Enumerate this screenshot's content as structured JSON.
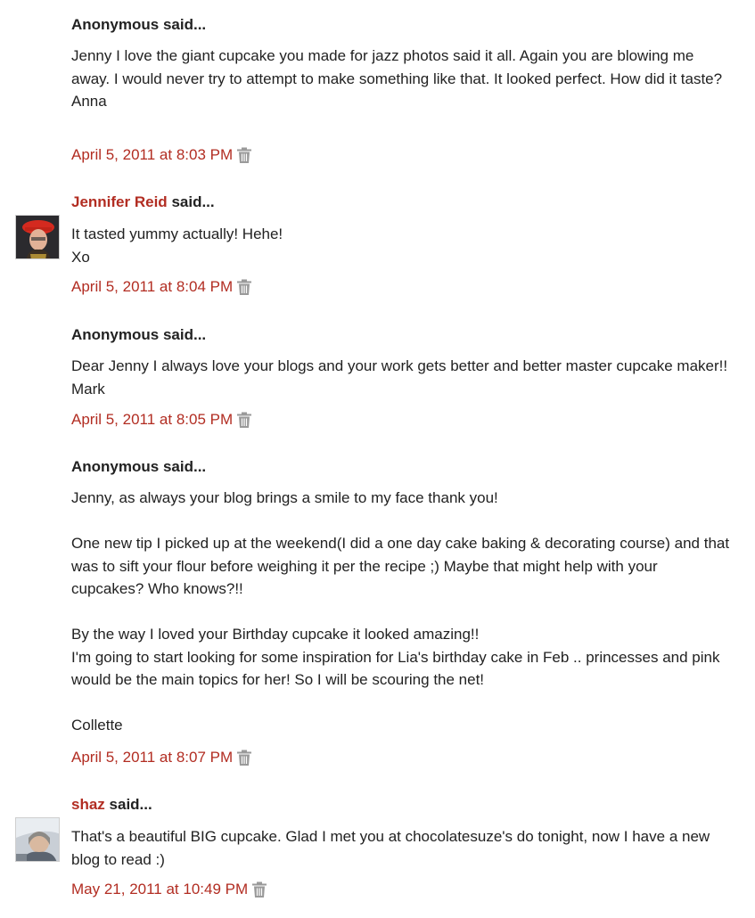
{
  "colors": {
    "link": "#b22d22",
    "text": "#222222",
    "icon": "#9a9a9a"
  },
  "comments": [
    {
      "author": "Anonymous",
      "said": "said...",
      "body": [
        "Jenny I love the giant cupcake you made for jazz photos said it all. Again you are blowing me away. I would never try to attempt to make something like that. It looked perfect. How did it taste?",
        "Anna"
      ],
      "timestamp": "April 5, 2011 at 8:03 PM",
      "delete_icon": "trash-icon"
    },
    {
      "author": "Jennifer Reid",
      "said": "said...",
      "avatar_icon": "avatar-red-beret",
      "body": [
        "It tasted yummy actually! Hehe!",
        "Xo"
      ],
      "timestamp": "April 5, 2011 at 8:04 PM",
      "delete_icon": "trash-icon"
    },
    {
      "author": "Anonymous",
      "said": "said...",
      "body": [
        "Dear Jenny I always love your blogs and your work gets better and better master cupcake maker!! Mark"
      ],
      "timestamp": "April 5, 2011 at 8:05 PM",
      "delete_icon": "trash-icon"
    },
    {
      "author": "Anonymous",
      "said": "said...",
      "body": [
        "Jenny, as always your blog brings a smile to my face thank you!",
        "One new tip I picked up at the weekend(I did a one day cake baking & decorating course) and that was to sift your flour before weighing it per the recipe ;) Maybe that might help with your cupcakes? Who knows?!!",
        "By the way I loved your Birthday cupcake it looked amazing!!",
        "I'm going to start looking for some inspiration for Lia's birthday cake in Feb .. princesses and pink would be the main topics for her! So I will be scouring the net!",
        "Collette"
      ],
      "timestamp": "April 5, 2011 at 8:07 PM",
      "delete_icon": "trash-icon"
    },
    {
      "author": "shaz",
      "said": "said...",
      "avatar_icon": "avatar-photo",
      "body": [
        "That's a beautiful BIG cupcake. Glad I met you at chocolatesuze's do tonight, now I have a new blog to read :)"
      ],
      "timestamp": "May 21, 2011 at 10:49 PM",
      "delete_icon": "trash-icon"
    }
  ]
}
